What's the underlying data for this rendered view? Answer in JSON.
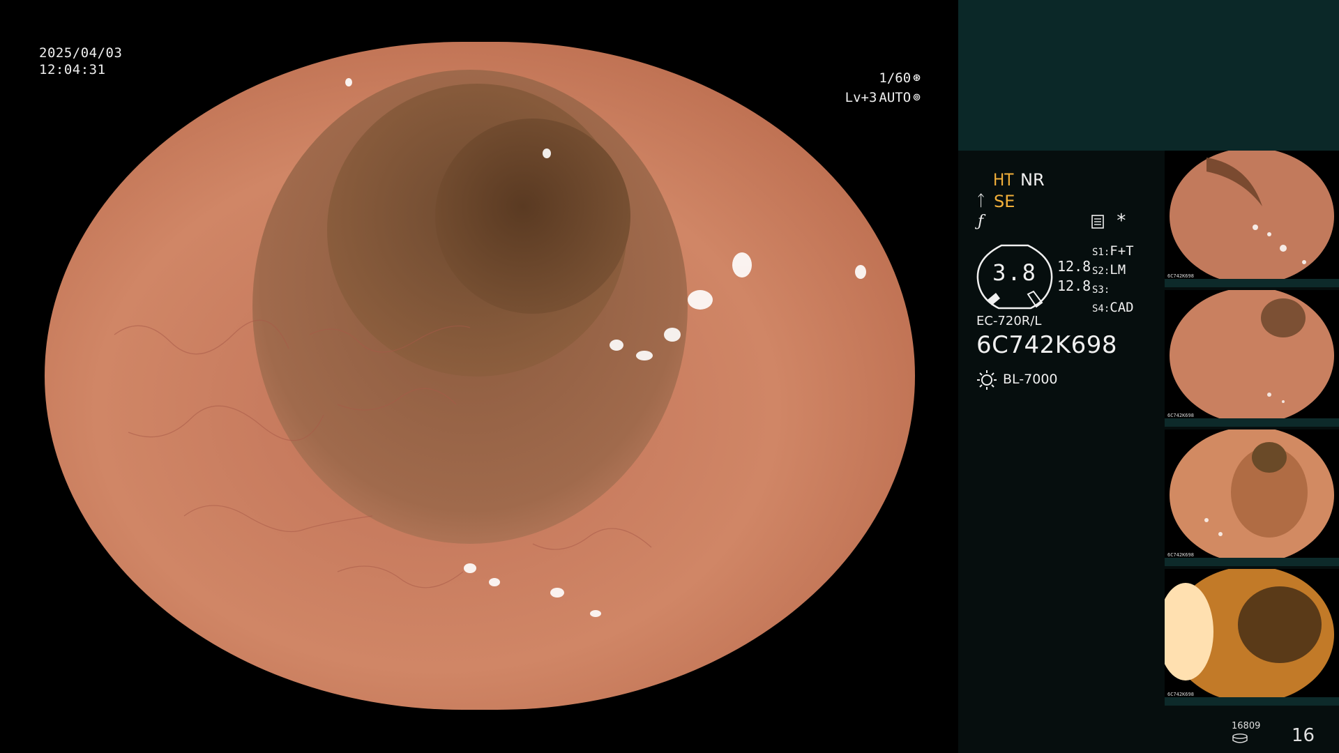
{
  "overlay": {
    "date": "2025/04/03",
    "time": "12:04:31",
    "shutter": "1/60",
    "shutter_icon": "aperture-icon",
    "level": "Lv+3",
    "mode": "AUTO",
    "mode_icon": "iris-icon"
  },
  "panel": {
    "ht": "HT",
    "nr": "NR",
    "se": "SE",
    "se_icon_glyph": "ᛏ",
    "f_glyph": "ƒ",
    "star": "*",
    "gauge_value": "3.8",
    "value_a": "12.8",
    "value_b": "12.8",
    "settings": [
      {
        "key": "S1:",
        "val": "F+T"
      },
      {
        "key": "S2:",
        "val": "LM"
      },
      {
        "key": "S3:",
        "val": ""
      },
      {
        "key": "S4:",
        "val": "CAD"
      }
    ],
    "scope_model": "EC-720R/L",
    "scope_serial": "6C742K698",
    "light_source": "BL-7000",
    "disk_count": "16809",
    "image_count": "16"
  },
  "thumbnails": [
    {
      "id_line": "6C742K698"
    },
    {
      "id_line": "6C742K698"
    },
    {
      "id_line": "6C742K698"
    },
    {
      "id_line": "6C742K698"
    }
  ],
  "colors": {
    "accent_orange": "#f3b03a",
    "panel_bg": "#060e0e",
    "band_bg": "#0b2828",
    "mucosa": "#c97a5a"
  }
}
